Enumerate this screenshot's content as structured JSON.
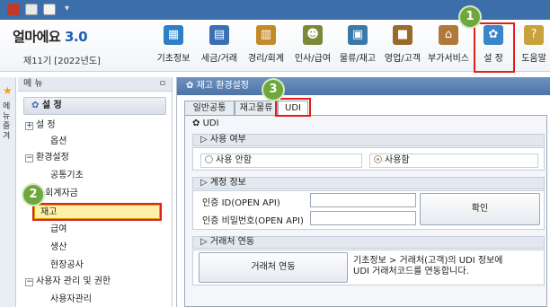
{
  "app": {
    "name": "얼마에요",
    "version": "3.0",
    "period": "제11기 [2022년도]"
  },
  "toolbar": {
    "items": [
      {
        "label": "기초정보",
        "icon": "basic-info-icon",
        "color": "#2f7fc4"
      },
      {
        "label": "세금/거래",
        "icon": "tax-document-icon",
        "color": "#3b6fb3"
      },
      {
        "label": "경리/회계",
        "icon": "accounting-icon",
        "color": "#c48a2a"
      },
      {
        "label": "인사/급여",
        "icon": "people-icon",
        "color": "#7a8a3a"
      },
      {
        "label": "물류/재고",
        "icon": "truck-icon",
        "color": "#3a7aa8"
      },
      {
        "label": "영업/고객",
        "icon": "briefcase-icon",
        "color": "#9a6a2a"
      },
      {
        "label": "부가서비스",
        "icon": "building-icon",
        "color": "#b0783a"
      },
      {
        "label": "설 정",
        "icon": "gear-icon",
        "color": "#3a86c8"
      },
      {
        "label": "도움말",
        "icon": "help-book-icon",
        "color": "#c8a23a"
      }
    ]
  },
  "sidebar": {
    "tab_label": "메뉴 즐겨",
    "header": "메 뉴",
    "pin": "ㅁ",
    "section": "설 정",
    "items": [
      {
        "label": "설 정",
        "expander": "+"
      },
      {
        "label": "옵션",
        "expander": ""
      },
      {
        "label": "환경설정",
        "expander": "−"
      },
      {
        "label": "공통기초",
        "expander": ""
      },
      {
        "label": "회계자금",
        "expander": ""
      },
      {
        "label": "재고",
        "expander": ""
      },
      {
        "label": "급여",
        "expander": ""
      },
      {
        "label": "생산",
        "expander": ""
      },
      {
        "label": "현장공사",
        "expander": ""
      },
      {
        "label": "사용자 관리 및 권한",
        "expander": "−"
      },
      {
        "label": "사용자관리",
        "expander": ""
      }
    ]
  },
  "content": {
    "title": "재고 환경설정",
    "tabs": [
      "일반공통",
      "재고물류",
      "UDI"
    ],
    "udi_title": "UDI",
    "use_group": {
      "title": "사용 여부",
      "options": [
        "사용 안함",
        "사용함"
      ],
      "selected": "사용함"
    },
    "account_group": {
      "title": "계정 정보",
      "id_label": "인증 ID(OPEN API)",
      "pw_label": "인증 비밀번호(OPEN API)",
      "id_value": "",
      "pw_value": "",
      "confirm_label": "확인"
    },
    "partner_group": {
      "title": "거래처 연동",
      "button_label": "거래처 연동",
      "desc_line1": "기초정보 > 거래처(고객)의 UDI 정보에",
      "desc_line2": "UDI 거래처코드를 연동합니다."
    }
  },
  "callouts": [
    "1",
    "2",
    "3"
  ],
  "colors": {
    "titlebar": "#3c6fa9",
    "panel_header": "#5b80b2",
    "selected_menu": "#fff2a8",
    "callout_badge": "#6ea83d",
    "highlight_border": "#e0201c"
  }
}
